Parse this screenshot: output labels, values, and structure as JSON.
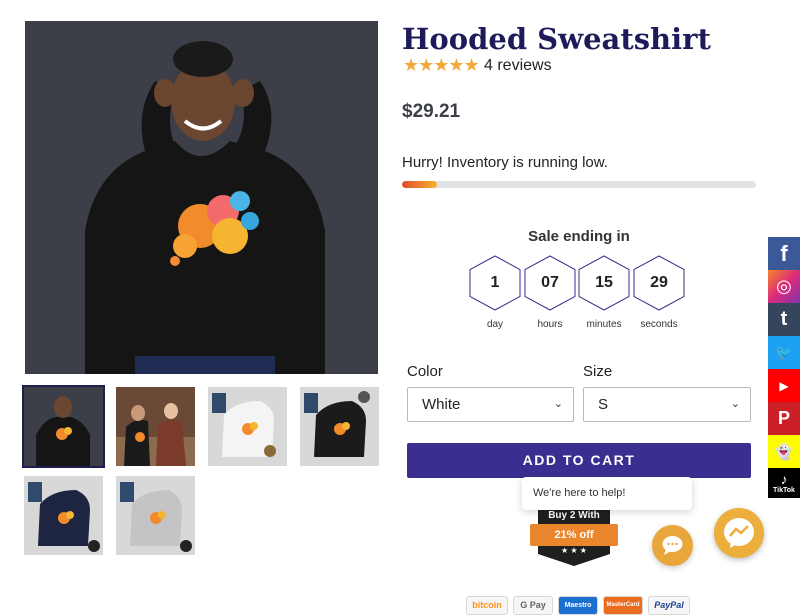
{
  "product": {
    "title": "Hooded Sweatshirt",
    "stars": "★★★★★",
    "reviews": "4 reviews",
    "price": "$29.21"
  },
  "inventory": {
    "message": "Hurry! Inventory is running low.",
    "level_fraction": 0.1
  },
  "sale": {
    "title": "Sale ending in",
    "units": [
      {
        "value": "1",
        "label": "day"
      },
      {
        "value": "07",
        "label": "hours"
      },
      {
        "value": "15",
        "label": "minutes"
      },
      {
        "value": "29",
        "label": "seconds"
      }
    ]
  },
  "options": {
    "color_label": "Color",
    "color_value": "White",
    "size_label": "Size",
    "size_value": "S"
  },
  "cart": {
    "button_label": "ADD TO CART"
  },
  "chat": {
    "help_text": "We're here to help!"
  },
  "badge": {
    "top": "Buy 2 With",
    "ribbon": "21% off",
    "stars": "★ ★ ★"
  },
  "social": [
    {
      "icon": "facebook-icon",
      "glyph": "f",
      "color": "#3b5998"
    },
    {
      "icon": "instagram-icon",
      "glyph": "◎",
      "color": "#e1306c"
    },
    {
      "icon": "tumblr-icon",
      "glyph": "t",
      "color": "#35465c"
    },
    {
      "icon": "twitter-icon",
      "glyph": "🐦",
      "color": "#1da1f2"
    },
    {
      "icon": "youtube-icon",
      "glyph": "▶",
      "color": "#ff0000"
    },
    {
      "icon": "pinterest-icon",
      "glyph": "P",
      "color": "#cb2027"
    },
    {
      "icon": "snapchat-icon",
      "glyph": "👻",
      "color": "#fffc00"
    },
    {
      "icon": "tiktok-icon",
      "glyph": "♪",
      "color": "#000000",
      "text": "TikTok"
    }
  ],
  "payments": [
    {
      "name": "bitcoin",
      "text": "bitcoin"
    },
    {
      "name": "google-pay",
      "text": "G Pay"
    },
    {
      "name": "maestro",
      "text": "Maestro"
    },
    {
      "name": "mastercard",
      "text": "MasterCard"
    },
    {
      "name": "paypal",
      "text": "PayPal"
    }
  ],
  "colors": {
    "title": "#1e1b5a",
    "accent": "#3a2e90",
    "star": "#f2a93b",
    "chat": "#e9a63a"
  }
}
